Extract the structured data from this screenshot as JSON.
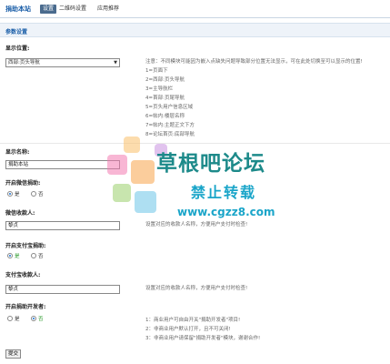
{
  "header": {
    "title": "捐助本站",
    "tabs": [
      {
        "label": "设置",
        "active": true
      },
      {
        "label": "二维码设置",
        "active": false
      },
      {
        "label": "应用推荐",
        "active": false
      }
    ]
  },
  "section": {
    "title": "参数设置"
  },
  "display_position": {
    "label": "显示位置:",
    "selected": "西部:页头导航",
    "notes": [
      "注意：不同模块可能因为嵌入点缺失问题导致部分位置无法显示，可在此处切换至可以显示的位置!",
      "1=页面下",
      "2=西部:页头导航",
      "3=主导航栏",
      "4=首部:页尾导航",
      "5=页头用户信息区域",
      "6=帖内:楼层名称",
      "7=帖内:主题正文下方",
      "8=论坛首页:底部导航"
    ]
  },
  "display_name": {
    "label": "显示名称:",
    "value": "捐助本站"
  },
  "enable_wechat": {
    "label": "开启微信捐助:",
    "options": [
      "是",
      "否"
    ],
    "selected": 0
  },
  "wechat_payee": {
    "label": "微信收款人:",
    "value": "黎贞",
    "note": "设置对应的收款人名称，方便用户支付时检查!"
  },
  "enable_alipay": {
    "label": "开启支付宝捐助:",
    "options": [
      "是",
      "否"
    ],
    "selected": 0
  },
  "alipay_payee": {
    "label": "支付宝收款人:",
    "value": "黎贞",
    "note": "设置对应的收款人名称，方便用户支付时检查!"
  },
  "enable_donor_list": {
    "label": "开启捐助开发者:",
    "options": [
      "是",
      "否"
    ],
    "selected": 1,
    "notes": [
      "1：商业用户可自由开关\"捐助开发者\"项目!",
      "2：非商业用户默认打开，且不可关闭!",
      "3：非商业用户请保留\"捐助开发者\"模块，谢谢合作!"
    ]
  },
  "submit_label": "提交",
  "watermark": {
    "title": "草根吧论坛",
    "subtitle": "禁止转载",
    "url": "www.cgzz8.com"
  },
  "colors": {
    "accent": "#1a5ea8",
    "tab_active_bg": "#4a6b8e",
    "radio_on": "#1a6fd0",
    "watermark": "#1d8a8a"
  }
}
